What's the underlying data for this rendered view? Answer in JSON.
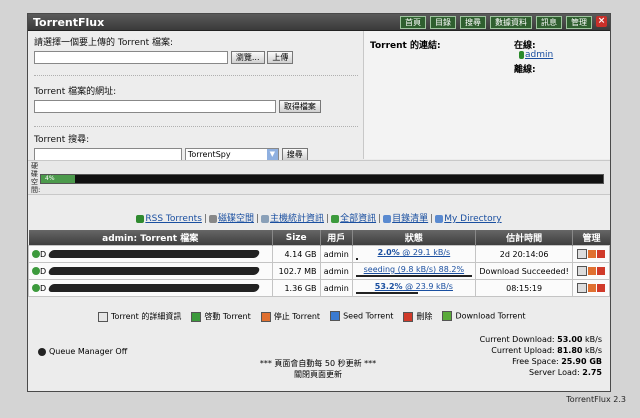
{
  "app_title": "TorrentFlux",
  "nav": [
    "首頁",
    "目錄",
    "搜尋",
    "數據資料",
    "訊息",
    "管理"
  ],
  "upload": {
    "label": "請選擇一個要上傳的 Torrent 檔案:",
    "browse_label": "瀏覽...",
    "upload_label": "上傳"
  },
  "url": {
    "label": "Torrent 檔案的網址:",
    "fetch_label": "取得檔案"
  },
  "search": {
    "label": "Torrent 搜尋:",
    "engine": "TorrentSpy",
    "go_label": "搜尋"
  },
  "links_panel": {
    "title": "Torrent 的連結:",
    "online_label": "在線:",
    "online_user": "admin",
    "offline_label": "離線:"
  },
  "disk": {
    "label": "硬碟空間:",
    "percent_text": "4%",
    "percent": 4
  },
  "quick_links": [
    {
      "label": "RSS Torrents",
      "color": "#2f8a2f"
    },
    {
      "label": "磁碟空間",
      "color": "#888888"
    },
    {
      "label": "主機統計資訊",
      "color": "#8aa0b8"
    },
    {
      "label": "全部資訊",
      "color": "#3c9a3c"
    },
    {
      "label": "目錄清單",
      "color": "#5a8ad0"
    },
    {
      "label": "My Directory",
      "color": "#5a8ad0"
    }
  ],
  "table": {
    "headers": [
      "admin: Torrent 檔案",
      "Size",
      "用戶",
      "狀態",
      "估計時間",
      "管理"
    ],
    "rows": [
      {
        "name": "D",
        "size": "4.14 GB",
        "user": "admin",
        "status_bold": "2.0%",
        "status_rest": " @ 29.1 kB/s",
        "progress": 2,
        "eta": "2d 20:14:06"
      },
      {
        "name": "D",
        "size": "102.7 MB",
        "user": "admin",
        "status_bold": "",
        "status_rest": "seeding (9.8 kB/s) 88.2%",
        "progress": 100,
        "eta": "Download Succeeded!"
      },
      {
        "name": "D",
        "size": "1.36 GB",
        "user": "admin",
        "status_bold": "53.2%",
        "status_rest": " @ 23.9 kB/s",
        "progress": 53.2,
        "eta": "08:15:19"
      }
    ]
  },
  "legend": [
    {
      "label": "Torrent 的詳細資訊",
      "color": "#e6e6e6"
    },
    {
      "label": "啓動 Torrent",
      "color": "#3c9a3c"
    },
    {
      "label": "停止 Torrent",
      "color": "#e07030"
    },
    {
      "label": "Seed Torrent",
      "color": "#3a7ad0"
    },
    {
      "label": "刪除",
      "color": "#d03a2a"
    },
    {
      "label": "Download Torrent",
      "color": "#5aaa3a"
    }
  ],
  "queue_manager": "Queue Manager Off",
  "refresh_line1": "*** 頁面會自動每 50 秒更新 ***",
  "refresh_line2": "關閉頁面更新",
  "stats": [
    {
      "label": "Current Download: ",
      "value": "53.00",
      "unit": " kB/s"
    },
    {
      "label": "Current Upload: ",
      "value": "81.80",
      "unit": " kB/s"
    },
    {
      "label": "Free Space: ",
      "value": "25.90 GB",
      "unit": ""
    },
    {
      "label": "Server Load: ",
      "value": "2.75",
      "unit": ""
    }
  ],
  "version": "TorrentFlux 2.3"
}
